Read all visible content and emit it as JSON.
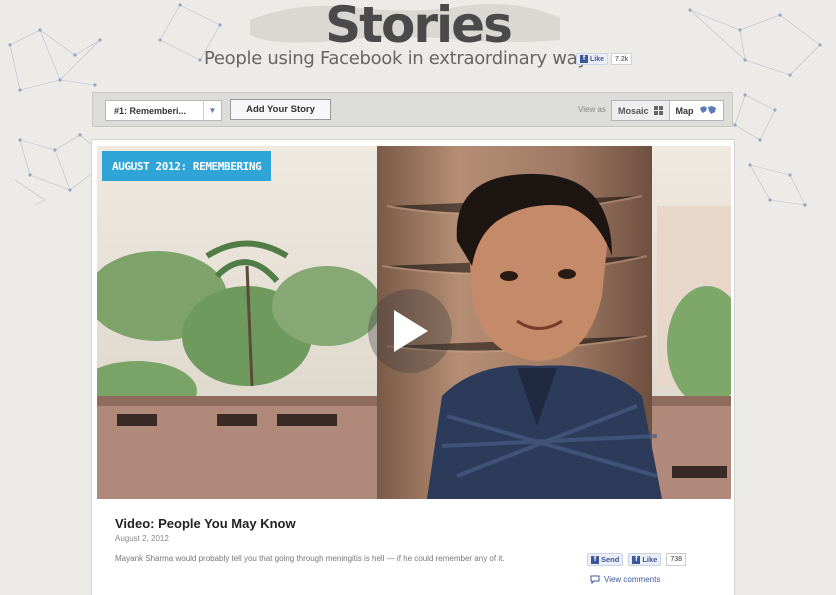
{
  "header": {
    "title": "Stories",
    "tagline": "People using Facebook in extraordinary ways",
    "like_label": "Like",
    "like_count": "7.2k"
  },
  "toolbar": {
    "story_select": "#1: Rememberi...",
    "add_story": "Add Your Story",
    "view_as": "View as",
    "view_mosaic": "Mosaic",
    "view_map": "Map"
  },
  "story": {
    "banner": "AUGUST 2012: REMEMBERING",
    "title": "Video: People You May Know",
    "date": "August 2, 2012",
    "excerpt": "Mayank Sharma would probably tell you that going through meningitis is hell — if he could remember any of it.",
    "send_label": "Send",
    "like_label": "Like",
    "like_count": "738",
    "view_comments": "View comments"
  },
  "colors": {
    "banner": "#2fa4d6",
    "facebook_blue": "#3b5998",
    "background": "#ecebe7"
  },
  "icons": [
    "facebook-icon",
    "mosaic-icon",
    "map-icon",
    "play-icon",
    "comment-icon",
    "dropdown-arrow-icon"
  ]
}
